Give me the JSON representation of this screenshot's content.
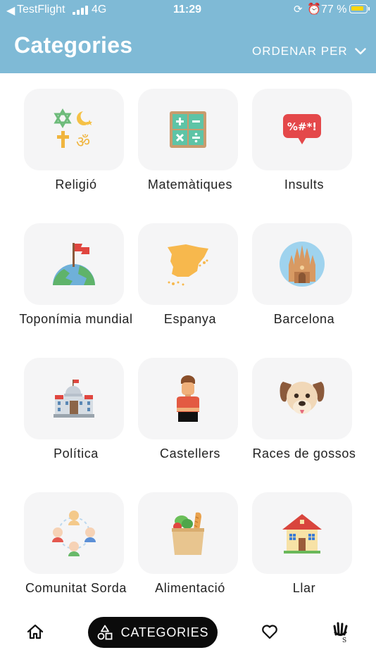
{
  "status_bar": {
    "back_glyph": "◀",
    "carrier": "TestFlight",
    "network": "4G",
    "time": "11:29",
    "battery": "77 %",
    "battery_color": "#ffd60a"
  },
  "header": {
    "title": "Categories",
    "sort_label": "ORDENAR PER",
    "background": "#7fbad6"
  },
  "categories": [
    {
      "label": "Religió",
      "icon": "religion-symbols-icon"
    },
    {
      "label": "Matemàtiques",
      "icon": "math-calculator-icon"
    },
    {
      "label": "Insults",
      "icon": "swear-speech-bubble-icon"
    },
    {
      "label": "Toponímia mundial",
      "icon": "flag-on-globe-icon"
    },
    {
      "label": "Espanya",
      "icon": "spain-map-icon"
    },
    {
      "label": "Barcelona",
      "icon": "sagrada-familia-icon"
    },
    {
      "label": "Política",
      "icon": "government-building-icon"
    },
    {
      "label": "Castellers",
      "icon": "casteller-person-icon"
    },
    {
      "label": "Races de gossos",
      "icon": "dog-face-icon"
    },
    {
      "label": "Comunitat Sorda",
      "icon": "community-people-icon"
    },
    {
      "label": "Alimentació",
      "icon": "grocery-bag-icon"
    },
    {
      "label": "Llar",
      "icon": "house-icon"
    }
  ],
  "insults_text": "%#*!",
  "bottom_nav": {
    "home_icon": "home-icon",
    "categories_label": "CATEGORIES",
    "categories_icon": "shapes-icon",
    "favorites_icon": "heart-icon",
    "sign_icon": "sign-language-hand-icon"
  }
}
